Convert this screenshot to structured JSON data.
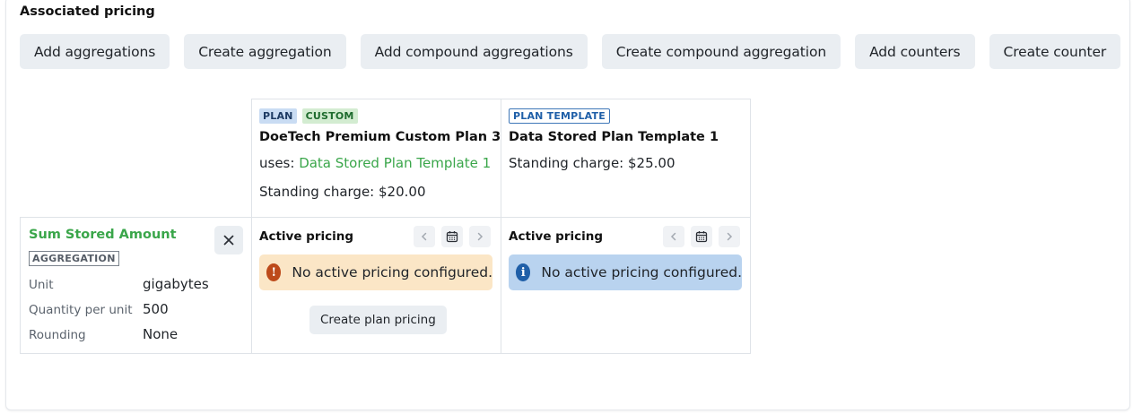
{
  "section": {
    "title": "Associated pricing"
  },
  "toolbar": {
    "buttons": [
      "Add aggregations",
      "Create aggregation",
      "Add compound aggregations",
      "Create compound aggregation",
      "Add counters",
      "Create counter"
    ]
  },
  "plans": [
    {
      "tags": [
        "PLAN",
        "CUSTOM"
      ],
      "name": "DoeTech Premium Custom Plan 3",
      "uses_label": "uses: ",
      "uses_link": "Data Stored Plan Template 1",
      "standing_charge": "Standing charge: $20.00"
    },
    {
      "tags": [
        "PLAN TEMPLATE"
      ],
      "name": "Data Stored Plan Template 1",
      "standing_charge": "Standing charge: $25.00"
    }
  ],
  "aggregation": {
    "name": "Sum Stored Amount",
    "tag": "AGGREGATION",
    "fields": [
      {
        "label": "Unit",
        "value": "gigabytes"
      },
      {
        "label": "Quantity per unit",
        "value": "500"
      },
      {
        "label": "Rounding",
        "value": "None"
      }
    ]
  },
  "pricing": [
    {
      "title": "Active pricing",
      "alert": "No active pricing configured.",
      "alert_type": "warning",
      "create_label": "Create plan pricing"
    },
    {
      "title": "Active pricing",
      "alert": "No active pricing configured.",
      "alert_type": "info"
    }
  ],
  "icons": {
    "close": "close-icon",
    "prev": "chevron-left-icon",
    "calendar": "calendar-icon",
    "next": "chevron-right-icon",
    "warning": "exclamation-circle-icon",
    "info": "info-circle-icon"
  },
  "colors": {
    "link_green": "#3aa64a",
    "warning_bg": "#fbe6c6",
    "warning_icon": "#bd4a1a",
    "info_bg": "#b9d3ef",
    "info_icon": "#1f5fa8",
    "button_bg": "#eaeef2"
  }
}
